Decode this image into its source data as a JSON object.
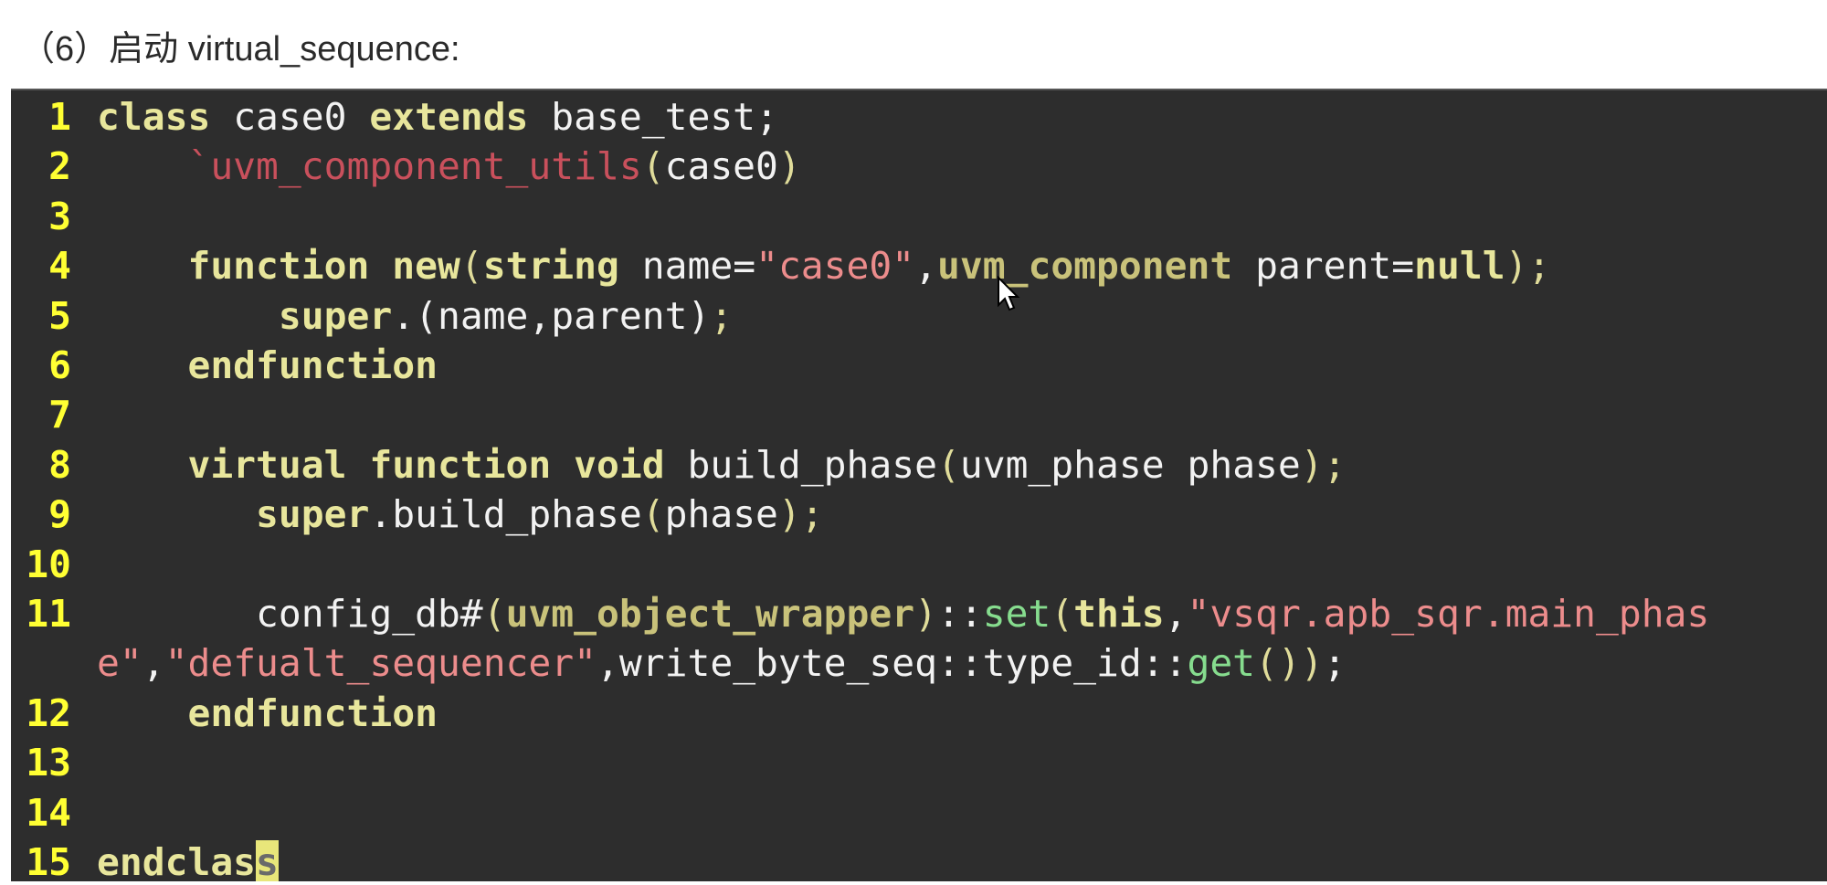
{
  "heading": "（6）启动 virtual_sequence:",
  "colors": {
    "background": "#2d2d2d",
    "line_number": "#ffff33",
    "keyword": "#e8e69c",
    "macro": "#c9505c",
    "string": "#ec8c8c",
    "function": "#86dc8e"
  },
  "code": [
    {
      "n": "1",
      "t": [
        [
          "kw",
          "class"
        ],
        [
          "",
          " case0 "
        ],
        [
          "kw",
          "extends"
        ],
        [
          "",
          " base_test;"
        ]
      ]
    },
    {
      "n": "2",
      "t": [
        [
          "",
          "    "
        ],
        [
          "mac",
          "`uvm_component_utils"
        ],
        [
          "pn",
          "("
        ],
        [
          "",
          "case0"
        ],
        [
          "pn",
          ")"
        ]
      ]
    },
    {
      "n": "3",
      "t": []
    },
    {
      "n": "4",
      "t": [
        [
          "",
          "    "
        ],
        [
          "kw",
          "function"
        ],
        [
          "",
          " "
        ],
        [
          "kw",
          "new"
        ],
        [
          "pn",
          "("
        ],
        [
          "kw",
          "string"
        ],
        [
          "",
          " name="
        ],
        [
          "str",
          "\"case0\""
        ],
        [
          "",
          ","
        ],
        [
          "ty",
          "uvm_component"
        ],
        [
          "",
          " parent="
        ],
        [
          "kw",
          "null"
        ],
        [
          "pn",
          ");"
        ]
      ]
    },
    {
      "n": "5",
      "t": [
        [
          "",
          "        "
        ],
        [
          "kw",
          "super"
        ],
        [
          "",
          ".(name,parent)"
        ],
        [
          "pn",
          ";"
        ]
      ]
    },
    {
      "n": "6",
      "t": [
        [
          "",
          "    "
        ],
        [
          "kw",
          "endfunction"
        ]
      ]
    },
    {
      "n": "7",
      "t": []
    },
    {
      "n": "8",
      "t": [
        [
          "",
          "    "
        ],
        [
          "kw",
          "virtual"
        ],
        [
          "",
          " "
        ],
        [
          "kw",
          "function"
        ],
        [
          "",
          " "
        ],
        [
          "kw",
          "void"
        ],
        [
          "",
          " build_phase"
        ],
        [
          "pn",
          "("
        ],
        [
          "",
          "uvm_phase phase"
        ],
        [
          "pn",
          ");"
        ]
      ]
    },
    {
      "n": "9",
      "t": [
        [
          "",
          "       "
        ],
        [
          "kw",
          "super"
        ],
        [
          "",
          ".build_phase"
        ],
        [
          "pn",
          "("
        ],
        [
          "",
          "phase"
        ],
        [
          "pn",
          ");"
        ]
      ]
    },
    {
      "n": "10",
      "t": []
    },
    {
      "n": "11",
      "t": [
        [
          "",
          "       config_db#"
        ],
        [
          "pn",
          "("
        ],
        [
          "ty",
          "uvm_object_wrapper"
        ],
        [
          "pn",
          ")"
        ],
        [
          "",
          "::"
        ],
        [
          "fn",
          "set"
        ],
        [
          "pn",
          "("
        ],
        [
          "kw",
          "this"
        ],
        [
          "",
          ","
        ],
        [
          "str",
          "\"vsqr.apb_sqr.main_phase\""
        ],
        [
          "",
          ","
        ],
        [
          "str",
          "\"defualt_sequencer\""
        ],
        [
          "",
          ",write_byte_seq::type_id::"
        ],
        [
          "fn",
          "get"
        ],
        [
          "pn",
          "())"
        ],
        [
          "",
          ";"
        ]
      ]
    },
    {
      "n": "12",
      "t": [
        [
          "",
          "    "
        ],
        [
          "kw",
          "endfunction"
        ]
      ]
    },
    {
      "n": "13",
      "t": []
    },
    {
      "n": "14",
      "t": []
    },
    {
      "n": "15",
      "t": [
        [
          "kw",
          "endclas"
        ],
        [
          "kw cur",
          "s"
        ]
      ]
    }
  ]
}
